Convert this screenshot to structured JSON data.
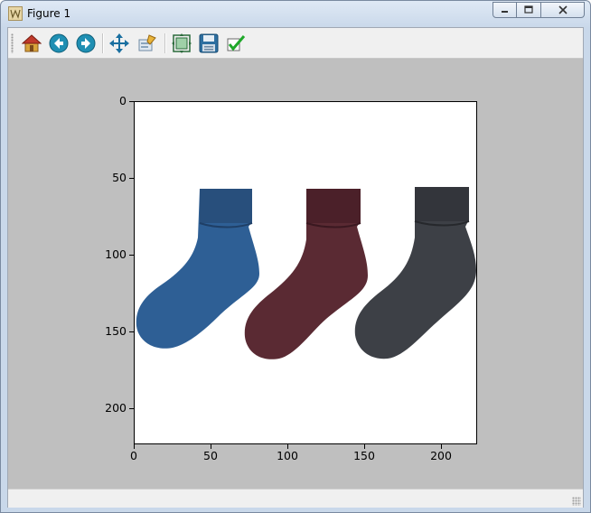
{
  "window": {
    "title": "Figure 1",
    "controls": [
      "minimize",
      "maximize",
      "close"
    ]
  },
  "toolbar": {
    "buttons": [
      {
        "name": "home",
        "icon": "home-icon",
        "tooltip": "Reset original view"
      },
      {
        "name": "back",
        "icon": "back-arrow-icon",
        "tooltip": "Back to previous view"
      },
      {
        "name": "forward",
        "icon": "forward-arrow-icon",
        "tooltip": "Forward to next view"
      },
      {
        "name": "pan",
        "icon": "move-arrows-icon",
        "tooltip": "Pan axes"
      },
      {
        "name": "zoom",
        "icon": "zoom-rect-icon",
        "tooltip": "Zoom to rectangle"
      },
      {
        "name": "subplots",
        "icon": "subplots-config-icon",
        "tooltip": "Configure subplots"
      },
      {
        "name": "save",
        "icon": "floppy-disk-icon",
        "tooltip": "Save the figure"
      },
      {
        "name": "edit",
        "icon": "checkmark-icon",
        "tooltip": "Edit curves"
      }
    ]
  },
  "axes": {
    "y_ticks": [
      "0",
      "50",
      "100",
      "150",
      "200"
    ],
    "x_ticks": [
      "0",
      "50",
      "100",
      "150",
      "200"
    ],
    "xlim": [
      0,
      224
    ],
    "ylim": [
      224,
      0
    ]
  },
  "image": {
    "description_colors": {
      "sock1": "#2e5f95",
      "sock2": "#5a2a33",
      "sock3": "#3d4046"
    }
  }
}
